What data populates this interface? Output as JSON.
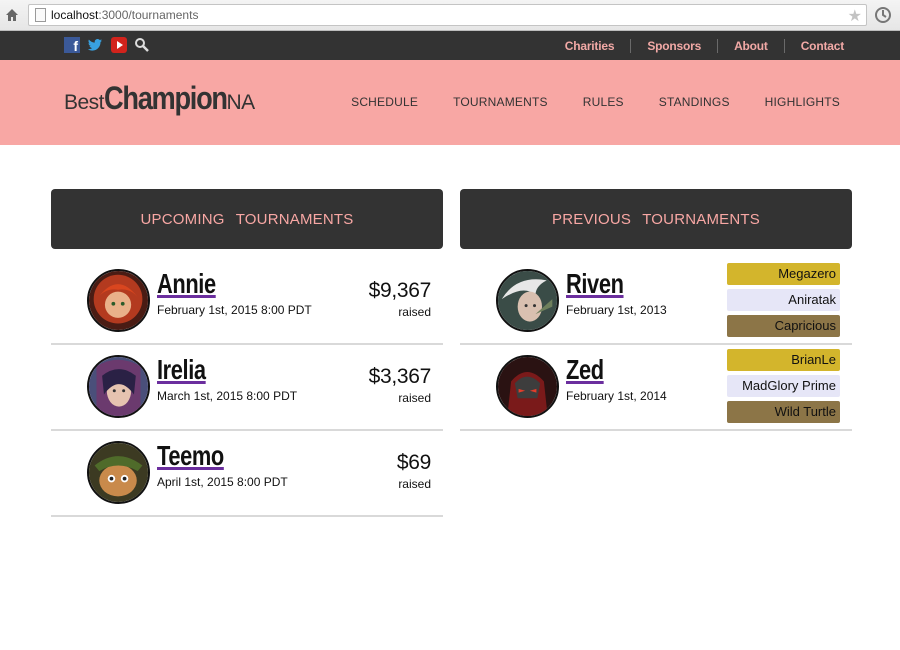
{
  "browser": {
    "url_host": "localhost",
    "url_path": ":3000/tournaments"
  },
  "topbar": {
    "social": [
      "facebook-icon",
      "twitter-icon",
      "youtube-icon",
      "search-icon"
    ],
    "links": [
      "Charities",
      "Sponsors",
      "About",
      "Contact"
    ]
  },
  "header": {
    "logo": {
      "part1": "Best",
      "part2": "Champion",
      "part3": "NA"
    },
    "nav": [
      "SCHEDULE",
      "TOURNAMENTS",
      "RULES",
      "STANDINGS",
      "HIGHLIGHTS"
    ]
  },
  "upcoming": {
    "title": "UPCOMING TOURNAMENTS",
    "items": [
      {
        "name": "Annie",
        "date": "February 1st, 2015 8:00 PDT",
        "amount": "$9,367",
        "label": "raised"
      },
      {
        "name": "Irelia",
        "date": "March 1st, 2015 8:00 PDT",
        "amount": "$3,367",
        "label": "raised"
      },
      {
        "name": "Teemo",
        "date": "April 1st, 2015 8:00 PDT",
        "amount": "$69",
        "label": "raised"
      }
    ]
  },
  "previous": {
    "title": "PREVIOUS TOURNAMENTS",
    "items": [
      {
        "name": "Riven",
        "date": "February 1st, 2013",
        "places": [
          "Megazero",
          "Aniratak",
          "Capricious"
        ]
      },
      {
        "name": "Zed",
        "date": "February 1st, 2014",
        "places": [
          "BrianLe",
          "MadGlory Prime",
          "Wild Turtle"
        ]
      }
    ]
  },
  "colors": {
    "accent_pink": "#f8a7a4",
    "dark": "#333333",
    "gold": "#d3b52c",
    "silver": "#e6e6f7",
    "bronze": "#8c7547",
    "underline_purple": "#6b2e9e"
  }
}
